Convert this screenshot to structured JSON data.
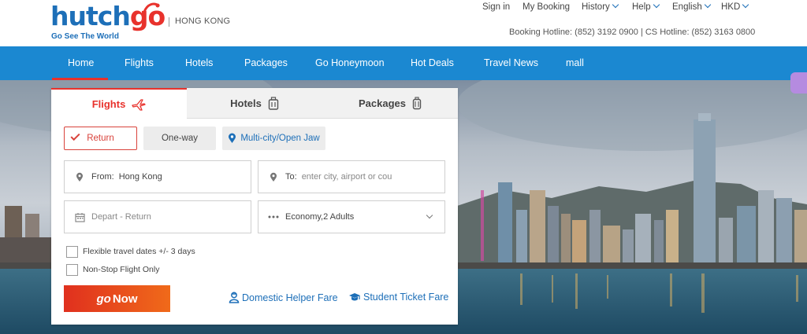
{
  "header": {
    "logo": {
      "word_part1": "hutch",
      "word_part2": "go",
      "tagline": "Go See The World"
    },
    "region": "HONG KONG",
    "top_links": {
      "sign_in": "Sign in",
      "my_booking": "My Booking",
      "history": "History",
      "help": "Help",
      "language": "English",
      "currency": "HKD"
    },
    "hotline": "Booking Hotline: (852) 3192 0900 | CS Hotline: (852) 3163 0800"
  },
  "main_nav": {
    "items": [
      "Home",
      "Flights",
      "Hotels",
      "Packages",
      "Go Honeymoon",
      "Hot Deals",
      "Travel News",
      "mall"
    ],
    "active_index": 0
  },
  "booking": {
    "tabs": [
      {
        "label": "Flights",
        "icon": "airplane-icon",
        "active": true
      },
      {
        "label": "Hotels",
        "icon": "luggage-icon",
        "active": false
      },
      {
        "label": "Packages",
        "icon": "suitcase-icon",
        "active": false
      }
    ],
    "trip_types": {
      "return": "Return",
      "one_way": "One-way",
      "multi_city": "Multi-city/Open Jaw",
      "selected": "Return"
    },
    "from": {
      "label": "From:",
      "value": "Hong Kong"
    },
    "to": {
      "label": "To:",
      "placeholder": "enter city, airport or cou"
    },
    "dates": {
      "placeholder": "Depart - Return"
    },
    "cabin": {
      "value": "Economy,2 Adults"
    },
    "options": {
      "flexible": "Flexible travel dates +/- 3 days",
      "nonstop": "Non-Stop Flight Only"
    },
    "go_button": {
      "go": "go",
      "now": "Now"
    },
    "links": {
      "domestic_helper": "Domestic Helper Fare",
      "student": "Student Ticket Fare"
    }
  },
  "colors": {
    "brand_blue": "#1d6fb8",
    "nav_blue": "#1b88d1",
    "brand_red": "#e8322c",
    "button_orange": "#f06a1a"
  }
}
